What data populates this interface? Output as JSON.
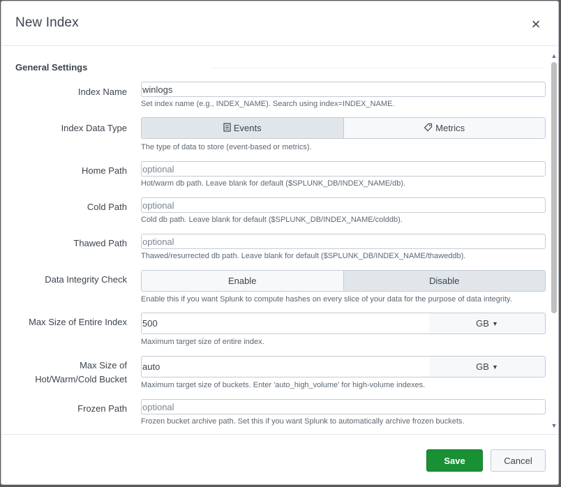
{
  "dialog": {
    "title": "New Index",
    "close_icon": "close-icon"
  },
  "section": {
    "title": "General Settings"
  },
  "index_name": {
    "label": "Index Name",
    "value": "winlogs",
    "help": "Set index name (e.g., INDEX_NAME). Search using index=INDEX_NAME."
  },
  "data_type": {
    "label": "Index Data Type",
    "options": [
      {
        "label": "Events",
        "icon": "document-icon",
        "selected": true
      },
      {
        "label": "Metrics",
        "icon": "tag-icon",
        "selected": false
      }
    ],
    "help": "The type of data to store (event-based or metrics)."
  },
  "home_path": {
    "label": "Home Path",
    "placeholder": "optional",
    "help": "Hot/warm db path. Leave blank for default ($SPLUNK_DB/INDEX_NAME/db)."
  },
  "cold_path": {
    "label": "Cold Path",
    "placeholder": "optional",
    "help": "Cold db path. Leave blank for default ($SPLUNK_DB/INDEX_NAME/colddb)."
  },
  "thawed_path": {
    "label": "Thawed Path",
    "placeholder": "optional",
    "help": "Thawed/resurrected db path. Leave blank for default ($SPLUNK_DB/INDEX_NAME/thaweddb)."
  },
  "integrity": {
    "label": "Data Integrity Check",
    "options": [
      {
        "label": "Enable",
        "selected": false
      },
      {
        "label": "Disable",
        "selected": true
      }
    ],
    "help": "Enable this if you want Splunk to compute hashes on every slice of your data for the purpose of data integrity."
  },
  "max_size": {
    "label": "Max Size of Entire Index",
    "value": "500",
    "unit": "GB",
    "help": "Maximum target size of entire index."
  },
  "max_bucket": {
    "label_line1": "Max Size of",
    "label_line2": "Hot/Warm/Cold Bucket",
    "value": "auto",
    "unit": "GB",
    "help": "Maximum target size of buckets. Enter 'auto_high_volume' for high-volume indexes."
  },
  "frozen_path": {
    "label": "Frozen Path",
    "placeholder": "optional",
    "help": "Frozen bucket archive path. Set this if you want Splunk to automatically archive frozen buckets."
  },
  "footer": {
    "save_label": "Save",
    "cancel_label": "Cancel"
  },
  "colors": {
    "primary": "#1a9035",
    "border": "#c3cbd4",
    "text": "#3c444d"
  }
}
